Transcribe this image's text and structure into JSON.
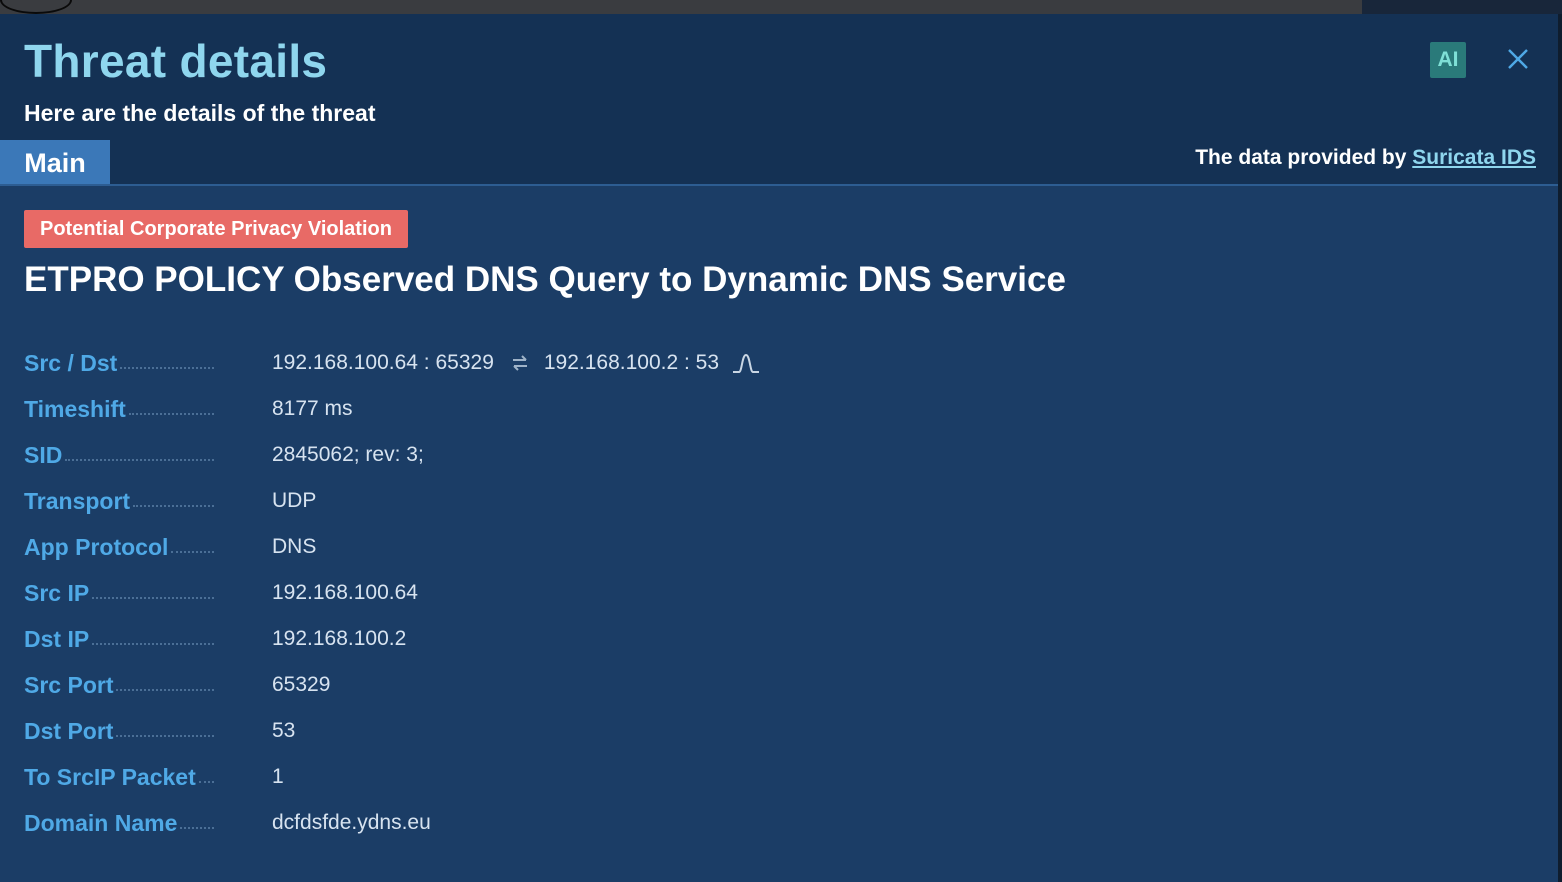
{
  "header": {
    "title": "Threat details",
    "subtitle": "Here are the details of the threat",
    "ai_label": "AI"
  },
  "tabs": [
    {
      "label": "Main",
      "active": true
    }
  ],
  "provider": {
    "prefix": "The data provided by",
    "link": "Suricata IDS"
  },
  "threat": {
    "category": "Potential Corporate Privacy Violation",
    "signature": "ETPRO POLICY Observed DNS Query to Dynamic DNS Service"
  },
  "details": {
    "src_dst": {
      "label": "Src / Dst",
      "src": "192.168.100.64 : 65329",
      "dst": "192.168.100.2 : 53"
    },
    "timeshift": {
      "label": "Timeshift",
      "value": "8177 ms"
    },
    "sid": {
      "label": "SID",
      "value": "2845062; rev: 3;"
    },
    "transport": {
      "label": "Transport",
      "value": "UDP"
    },
    "app_protocol": {
      "label": "App Protocol",
      "value": "DNS"
    },
    "src_ip": {
      "label": "Src IP",
      "value": "192.168.100.64"
    },
    "dst_ip": {
      "label": "Dst IP",
      "value": "192.168.100.2"
    },
    "src_port": {
      "label": "Src Port",
      "value": "65329"
    },
    "dst_port": {
      "label": "Dst Port",
      "value": "53"
    },
    "to_srcip_packet": {
      "label": "To SrcIP Packet",
      "value": "1"
    },
    "domain_name": {
      "label": "Domain Name",
      "value": "dcfdsfde.ydns.eu"
    }
  },
  "colors": {
    "title": "#8fd6ee",
    "label": "#4fa9e6",
    "badge": "#e86a66",
    "tab_active": "#3b78b8",
    "panel": "#1b3d66"
  },
  "icons": [
    "close-icon",
    "swap-arrows-icon",
    "signal-pulse-icon"
  ]
}
